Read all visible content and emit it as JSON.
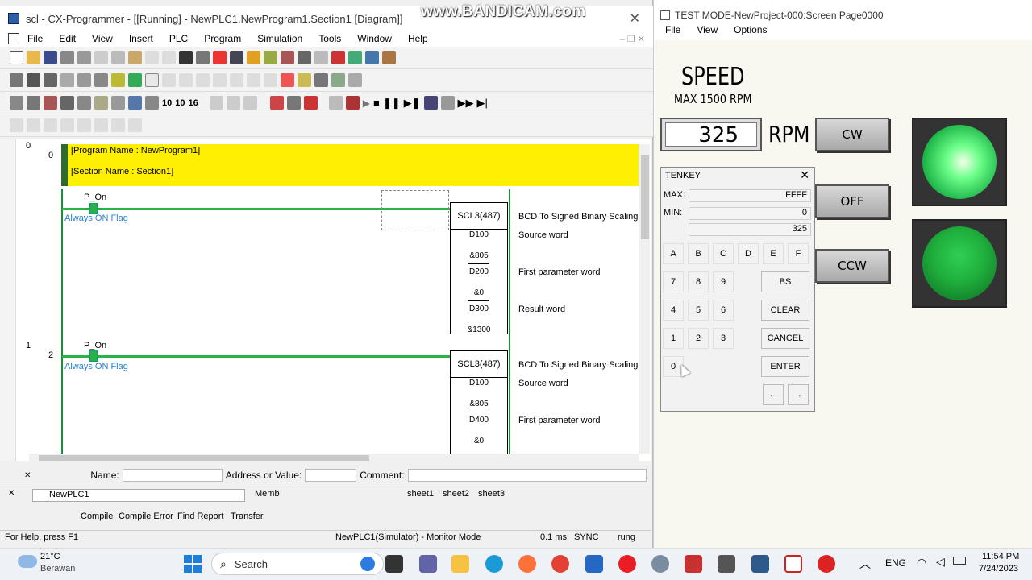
{
  "watermark": "www.BANDICAM.com",
  "cx": {
    "title": "scl - CX-Programmer - [[Running] - NewPLC1.NewProgram1.Section1 [Diagram]]",
    "menu": [
      "File",
      "Edit",
      "View",
      "Insert",
      "PLC",
      "Program",
      "Simulation",
      "Tools",
      "Window",
      "Help"
    ],
    "toolbar_nums": [
      "10",
      "10",
      "16"
    ],
    "rung0": {
      "num": "0",
      "step": "0",
      "program_name": "[Program Name : NewProgram1]",
      "section_name": "[Section Name : Section1]"
    },
    "rung1": {
      "contact_label": "P_On",
      "contact_comment": "Always ON Flag",
      "block": "SCL3(487)",
      "block_desc": "BCD To Signed Binary Scaling",
      "op1": "D100",
      "op1_desc": "Source word",
      "op2a": "&805",
      "op2": "D200",
      "op2_desc": "First parameter word",
      "op3a": "&0",
      "op3": "D300",
      "op3_desc": "Result word",
      "op3b": "&1300"
    },
    "rung2": {
      "num": "1",
      "step": "2",
      "contact_label": "P_On",
      "contact_comment": "Always ON Flag",
      "block": "SCL3(487)",
      "block_desc": "BCD To Signed Binary Scaling",
      "op1": "D100",
      "op1_desc": "Source word",
      "op2a": "&805",
      "op2": "D400",
      "op2_desc": "First parameter word",
      "op3a": "&0"
    },
    "namebar": {
      "name": "Name:",
      "address": "Address or Value:",
      "comment": "Comment:"
    },
    "tabs1": {
      "project": "NewPLC1",
      "memb": "Memb",
      "sheets": [
        "sheet1",
        "sheet2",
        "sheet3"
      ]
    },
    "tabs2": [
      "Compile",
      "Compile Error",
      "Find Report",
      "Transfer"
    ],
    "status": {
      "help": "For Help, press F1",
      "mode": "NewPLC1(Simulator) - Monitor Mode",
      "scan": "0.1 ms",
      "sync": "SYNC",
      "rung": "rung"
    }
  },
  "hmi": {
    "title": "TEST MODE-NewProject-000:Screen Page0000",
    "menu": [
      "File",
      "View",
      "Options"
    ],
    "speed_label": "SPEED",
    "max_label": "MAX 1500 RPM",
    "speed_value": "325",
    "unit": "RPM",
    "btn_cw": "CW",
    "btn_off": "OFF",
    "btn_ccw": "CCW",
    "colors": {
      "lamp_top": "#6dff8a",
      "lamp_bottom": "#1fae3c"
    },
    "tenkey": {
      "title": "TENKEY",
      "max_label": "MAX:",
      "max_value": "FFFF",
      "min_label": "MIN:",
      "min_value": "0",
      "current_value": "325",
      "hex_keys": [
        "A",
        "B",
        "C",
        "D",
        "E",
        "F"
      ],
      "num_keys": [
        "7",
        "8",
        "9",
        "4",
        "5",
        "6",
        "1",
        "2",
        "3",
        "0"
      ],
      "bs": "BS",
      "clear": "CLEAR",
      "cancel": "CANCEL",
      "enter": "ENTER",
      "left": "←",
      "right": "→"
    }
  },
  "taskbar": {
    "temp": "21°C",
    "weather": "Berawan",
    "search": "Search",
    "lang": "ENG",
    "time": "11:54 PM",
    "date": "7/24/2023"
  }
}
